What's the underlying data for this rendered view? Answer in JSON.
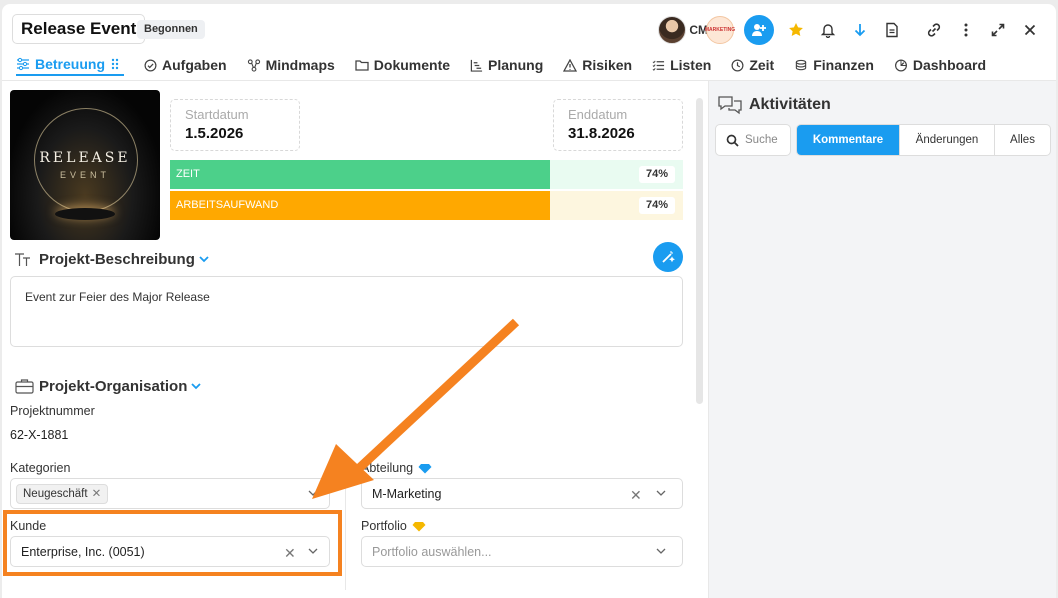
{
  "header": {
    "title": "Release Event",
    "status": "Begonnen",
    "avatar_initials": "CM",
    "avatar_badge": "MARKETING"
  },
  "tabs": [
    {
      "label": "Betreuung",
      "icon": "sliders-icon"
    },
    {
      "label": "Aufgaben",
      "icon": "check-circle-icon"
    },
    {
      "label": "Mindmaps",
      "icon": "mindmap-icon"
    },
    {
      "label": "Dokumente",
      "icon": "folder-icon"
    },
    {
      "label": "Planung",
      "icon": "gantt-icon"
    },
    {
      "label": "Risiken",
      "icon": "warning-icon"
    },
    {
      "label": "Listen",
      "icon": "list-icon"
    },
    {
      "label": "Zeit",
      "icon": "clock-icon"
    },
    {
      "label": "Finanzen",
      "icon": "coins-icon"
    },
    {
      "label": "Dashboard",
      "icon": "gauge-icon"
    }
  ],
  "image": {
    "line1": "RELEASE",
    "line2": "EVENT"
  },
  "dates": {
    "start_label": "Startdatum",
    "start_value": "1.5.2026",
    "end_label": "Enddatum",
    "end_value": "31.8.2026"
  },
  "progress": {
    "zeit_label": "ZEIT",
    "zeit_pct": "74%",
    "zeit_value": 0.74,
    "aufwand_label": "ARBEITSAUFWAND",
    "aufwand_pct": "74%",
    "aufwand_value": 0.74
  },
  "description": {
    "title": "Projekt-Beschreibung",
    "text": "Event zur Feier des Major Release"
  },
  "organisation": {
    "title": "Projekt-Organisation",
    "projektnummer_label": "Projektnummer",
    "projektnummer_value": "62-X-1881",
    "kategorien_label": "Kategorien",
    "kategorien_chip": "Neugeschäft",
    "abteilung_label": "Abteilung",
    "abteilung_value": "M-Marketing",
    "kunde_label": "Kunde",
    "kunde_value": "Enterprise, Inc. (0051)",
    "portfolio_label": "Portfolio",
    "portfolio_placeholder": "Portfolio auswählen..."
  },
  "activities": {
    "title": "Aktivitäten",
    "search_placeholder": "Suche",
    "filters": [
      "Kommentare",
      "Änderungen",
      "Alles"
    ]
  },
  "colors": {
    "accent": "#1a9cf0",
    "zeit_bar": "#4cd08a",
    "aufwand_bar": "#ffa800",
    "annotation": "#f58220"
  }
}
